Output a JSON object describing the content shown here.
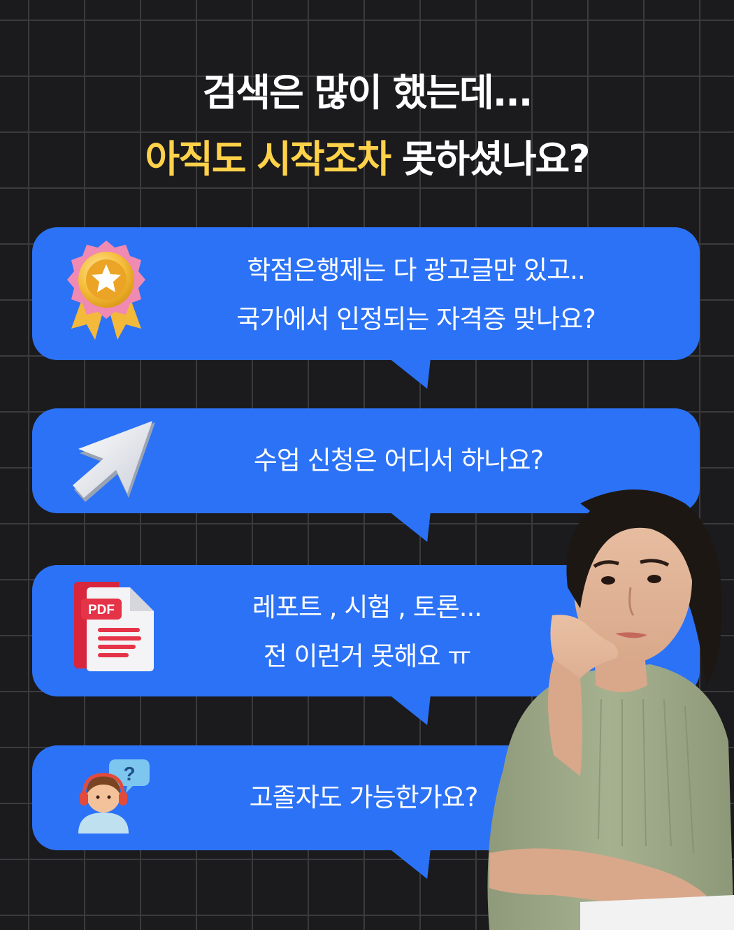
{
  "headline": {
    "line1": "검색은 많이 했는데...",
    "line2_highlight": "아직도 시작조차",
    "line2_rest": " 못하셨나요?"
  },
  "bubbles": [
    {
      "line1": "학점은행제는 다 광고글만 있고..",
      "line2": "국가에서 인정되는 자격증 맞나요?",
      "icon": "award-medal-icon"
    },
    {
      "line1": "수업 신청은 어디서 하나요?",
      "icon": "cursor-arrow-icon"
    },
    {
      "line1": "레포트 , 시험 , 토론...",
      "line2": "전 이런거 못해요 ㅠ",
      "icon": "pdf-document-icon"
    },
    {
      "line1": "고졸자도 가능한가요?",
      "icon": "student-question-icon"
    }
  ],
  "pdf_label": "PDF",
  "question_mark": "?",
  "colors": {
    "background": "#1b1a1c",
    "grid": "#3b3a3d",
    "bubble": "#2b72f6",
    "accent": "#ffd24a",
    "text": "#ffffff"
  }
}
